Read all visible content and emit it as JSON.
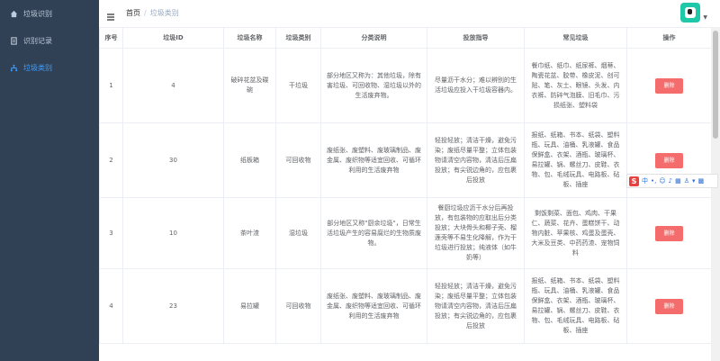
{
  "sidebar": {
    "items": [
      {
        "label": "垃圾识别",
        "icon": "home-icon",
        "active": false
      },
      {
        "label": "识别记录",
        "icon": "document-icon",
        "active": false
      },
      {
        "label": "垃圾类别",
        "icon": "tree-icon",
        "active": true
      }
    ]
  },
  "navbar": {
    "breadcrumb_home": "首页",
    "breadcrumb_sep": "/",
    "breadcrumb_current": "垃圾类别"
  },
  "table": {
    "headers": [
      "序号",
      "垃圾ID",
      "垃圾名称",
      "垃圾类别",
      "分类说明",
      "投放指导",
      "常见垃圾",
      "操作"
    ],
    "rows": [
      {
        "index": "1",
        "id": "4",
        "name": "破碎花盆及碟碗",
        "category": "干垃圾",
        "desc": "部分地区又称为：其他垃圾，除有害垃圾、可回收物、湿垃圾以外的生活废弃物。",
        "guide": "尽量沥干水分；难以辨别的生活垃圾应投入干垃圾容器内。",
        "common": "餐巾纸、纸巾、纸尿裤、烟蒂、陶瓷花盆、胶带、橡皮泥、创可贴、笔、灰土、眼镜、头发、内衣裤、防碎气泡膜、旧毛巾、污损纸张、塑料袋",
        "action": "删除"
      },
      {
        "index": "2",
        "id": "30",
        "name": "纸板箱",
        "category": "可回收物",
        "desc": "废纸张、废塑料、废玻璃制品、废金属、废织物等适宜回收、可循环利用的生活废弃物",
        "guide": "轻投轻放；清洁干燥，避免污染；废纸尽量平整；立体包装物请清空内容物，清洁后压扁投放；有尖锐边角的，应包裹后投放",
        "common": "报纸、纸箱、书本、纸袋、塑料瓶、玩具、油桶、乳液罐、食品保鲜盒、衣架、酒瓶、玻璃杯、易拉罐、锅、螺丝刀、皮鞋、衣物、包、毛绒玩具、电路板、砧板、插座",
        "action": "删除"
      },
      {
        "index": "3",
        "id": "10",
        "name": "茶叶渣",
        "category": "湿垃圾",
        "desc": "部分地区又称\"厨余垃圾\"，日常生活垃圾产生的容易腐烂的生物质废物。",
        "guide": "餐厨垃圾应沥干水分后再投放，有包装物的应取出后分类投放；大块骨头和椰子壳、榴莲壳等不易生化降解，作为干垃圾进行投放；纯液体（如牛奶等）",
        "common": "剩饭剩菜、面包、鸡肉、干果仁、蔬菜、花卉、蛋糕饼干、动物内脏、苹果核、鸡蛋及蛋壳、大米及豆类、中药药渣、宠物饲料",
        "action": "删除"
      },
      {
        "index": "4",
        "id": "23",
        "name": "易拉罐",
        "category": "可回收物",
        "desc": "废纸张、废塑料、废玻璃制品、废金属、废织物等适宜回收、可循环利用的生活废弃物",
        "guide": "轻投轻放；清洁干燥，避免污染；废纸尽量平整；立体包装物请清空内容物，清洁后压扁投放；有尖锐边角的，应包裹后投放",
        "common": "报纸、纸箱、书本、纸袋、塑料瓶、玩具、油桶、乳液罐、食品保鲜盒、衣架、酒瓶、玻璃杯、易拉罐、锅、螺丝刀、皮鞋、衣物、包、毛绒玩具、电路板、砧板、插座",
        "action": "删除"
      }
    ]
  },
  "ime": {
    "logo": "S",
    "lang": "中"
  },
  "colors": {
    "sidebar_bg": "#304156",
    "active": "#409eff",
    "danger": "#f56c6c"
  }
}
